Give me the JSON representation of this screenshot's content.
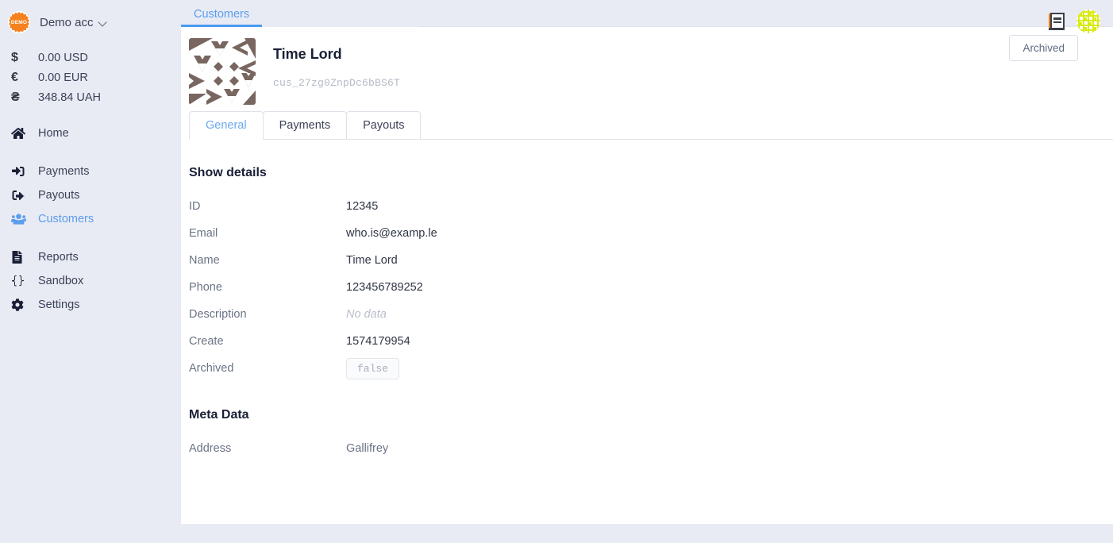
{
  "brand": {
    "logo_text": "DEMO",
    "account_name": "Demo acc",
    "chevron_icon": "chevron-down-icon"
  },
  "balances": [
    {
      "symbol": "$",
      "amount": "0.00 USD"
    },
    {
      "symbol": "€",
      "amount": "0.00 EUR"
    },
    {
      "symbol": "₴",
      "amount": "348.84 UAH"
    }
  ],
  "nav": {
    "groups": [
      {
        "items": [
          {
            "label": "Home",
            "icon": "home-icon",
            "active": false
          }
        ]
      },
      {
        "items": [
          {
            "label": "Payments",
            "icon": "sign-in-arrow-icon",
            "active": false
          },
          {
            "label": "Payouts",
            "icon": "sign-out-arrow-icon",
            "active": false
          },
          {
            "label": "Customers",
            "icon": "users-group-icon",
            "active": true
          }
        ]
      },
      {
        "items": [
          {
            "label": "Reports",
            "icon": "document-icon",
            "active": false
          },
          {
            "label": "Sandbox",
            "icon": "code-braces-icon",
            "active": false
          },
          {
            "label": "Settings",
            "icon": "gear-icon",
            "active": false
          }
        ]
      }
    ]
  },
  "topbar": {
    "browser_tab": "Customers",
    "book_icon": "book-icon",
    "avatar_icon": "user-avatar-identicon"
  },
  "customer": {
    "avatar_icon": "customer-identicon",
    "name": "Time Lord",
    "id_token": "cus_27zg0ZnpDc6bBS6T",
    "archived_button": "Archived"
  },
  "tabs": [
    {
      "label": "General",
      "active": true
    },
    {
      "label": "Payments",
      "active": false
    },
    {
      "label": "Payouts",
      "active": false
    }
  ],
  "details": {
    "title": "Show details",
    "rows": [
      {
        "label": "ID",
        "value": "12345",
        "style": "normal"
      },
      {
        "label": "Email",
        "value": "who.is@examp.le",
        "style": "normal"
      },
      {
        "label": "Name",
        "value": "Time Lord",
        "style": "normal"
      },
      {
        "label": "Phone",
        "value": "123456789252",
        "style": "normal"
      },
      {
        "label": "Description",
        "value": "No data",
        "style": "nodata"
      },
      {
        "label": "Create",
        "value": "1574179954",
        "style": "normal"
      },
      {
        "label": "Archived",
        "value": "false",
        "style": "badge"
      }
    ]
  },
  "meta": {
    "title": "Meta Data",
    "rows": [
      {
        "label": "Address",
        "value": "Gallifrey",
        "style": "muted"
      }
    ]
  },
  "colors": {
    "page_background": "#e8ebf4",
    "card_background": "#ffffff",
    "accent_blue": "#5c9ded",
    "brand_orange": "#f5821f",
    "identicon_brown": "#796660",
    "avatar_yellow": "#d9ea16",
    "label_gray": "#6b7385",
    "value_dark": "#2f3545"
  }
}
